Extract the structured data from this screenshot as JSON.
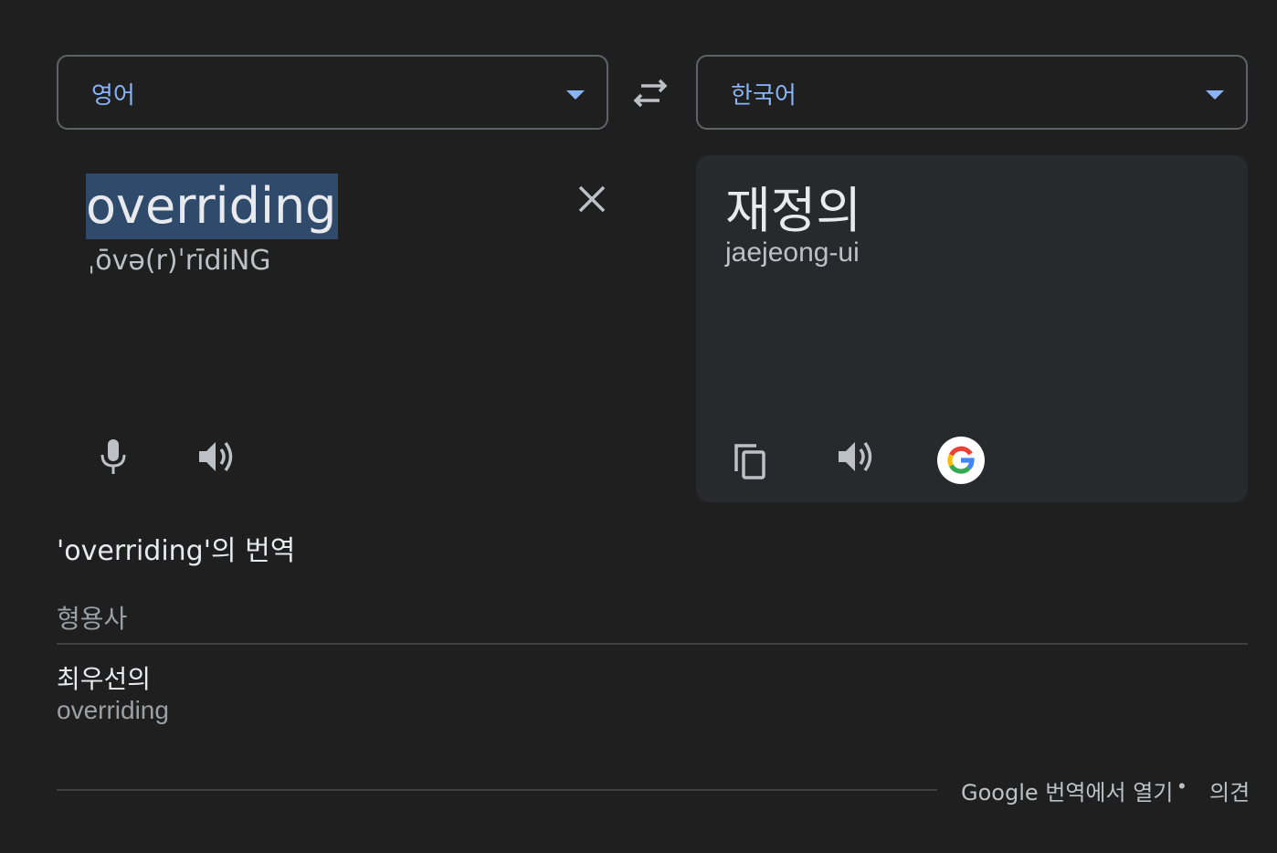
{
  "language_bar": {
    "source_language": "영어",
    "target_language": "한국어"
  },
  "source": {
    "text": "overriding",
    "phonetic": "ˌōvə(r)ˈrīdiNG"
  },
  "result": {
    "text": "재정의",
    "romanization": "jaejeong-ui"
  },
  "translations": {
    "heading": "'overriding'의 번역",
    "part_of_speech": "형용사",
    "entries": [
      {
        "word": "최우선의",
        "back_translation": "overriding"
      }
    ]
  },
  "footer": {
    "open_link": "Google 번역에서 열기",
    "separator": "•",
    "feedback_link": "의견"
  },
  "colors": {
    "background": "#1f1f1f",
    "accent": "#8ab4f8",
    "card": "#28292c",
    "selection": "#2f4a6a"
  },
  "icons": {
    "swap": "swap-arrows-icon",
    "clear": "close-icon",
    "mic": "microphone-icon",
    "source_speaker": "speaker-icon",
    "copy": "copy-icon",
    "target_speaker": "speaker-icon",
    "google": "google-logo-icon"
  }
}
